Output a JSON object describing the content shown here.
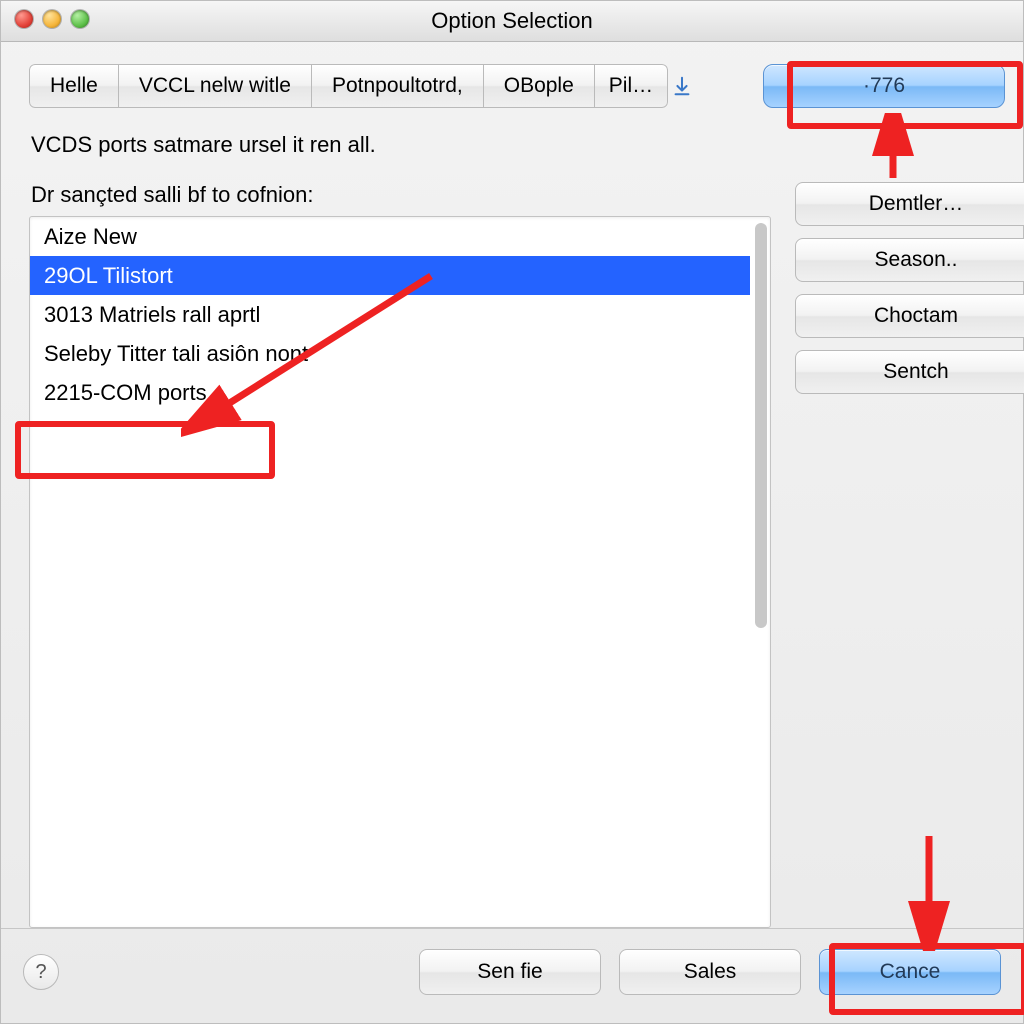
{
  "window": {
    "title": "Option Selection"
  },
  "toolbar": {
    "segments": [
      "Helle",
      "VCCL nelw witle",
      "Potnpoultotrd,",
      "OBople",
      "Pil…"
    ],
    "primary_label": "·776"
  },
  "description": "VCDS ports satmare ursel it ren all.",
  "list_label": "Dr sançted salli bf to cofnion:",
  "list_items": [
    "Aize New",
    "29OL Tilistort",
    "3013 Matriels rall aprtl",
    "Seleby Titter tali asiôn nont",
    "2215-COM ports"
  ],
  "list_selected_index": 1,
  "sidebar": {
    "buttons": [
      "Demtler…",
      "Season..",
      "Choctam",
      "Sentch"
    ]
  },
  "footer": {
    "help": "?",
    "buttons": [
      "Sen fie",
      "Sales"
    ],
    "primary": "Cance"
  },
  "annotations": {
    "highlight_list_index": 4
  }
}
